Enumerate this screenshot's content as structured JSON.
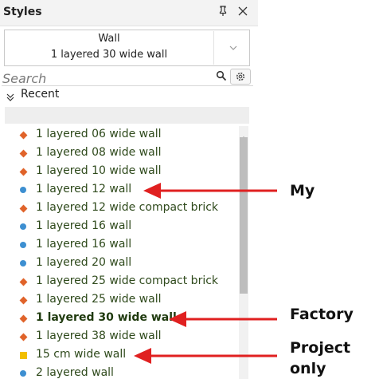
{
  "panel": {
    "title": "Styles"
  },
  "selector": {
    "category": "Wall",
    "style": "1 layered 30 wide wall"
  },
  "search": {
    "placeholder": "Search"
  },
  "recent": {
    "label": "Recent"
  },
  "items": [
    {
      "label": "1 layered 06 wide wall",
      "marker": "diamond",
      "bold": false
    },
    {
      "label": "1 layered 08 wide wall",
      "marker": "diamond",
      "bold": false
    },
    {
      "label": "1 layered 10 wide wall",
      "marker": "diamond",
      "bold": false
    },
    {
      "label": "1 layered 12 wall",
      "marker": "dot",
      "bold": false
    },
    {
      "label": "1 layered 12 wide compact brick",
      "marker": "diamond",
      "bold": false
    },
    {
      "label": "1 layered 16 wall",
      "marker": "dot",
      "bold": false
    },
    {
      "label": "1 layered 16 wall",
      "marker": "dot",
      "bold": false
    },
    {
      "label": "1 layered 20 wall",
      "marker": "dot",
      "bold": false
    },
    {
      "label": "1 layered 25 wide compact brick",
      "marker": "diamond",
      "bold": false
    },
    {
      "label": "1 layered 25 wide wall",
      "marker": "diamond",
      "bold": false
    },
    {
      "label": "1 layered 30 wide wall",
      "marker": "diamond",
      "bold": true
    },
    {
      "label": "1 layered 38 wide wall",
      "marker": "diamond",
      "bold": false
    },
    {
      "label": "15 cm wide wall",
      "marker": "square",
      "bold": false
    },
    {
      "label": "2 layered wall",
      "marker": "dot",
      "bold": false
    }
  ],
  "annotations": [
    {
      "text": "My"
    },
    {
      "text": "Factory"
    },
    {
      "text": "Project\nonly"
    }
  ],
  "colors": {
    "annotation_arrow": "#e02020",
    "diamond_marker": "#e0632a",
    "dot_marker": "#3d8fd1",
    "square_marker": "#f2bf00"
  }
}
